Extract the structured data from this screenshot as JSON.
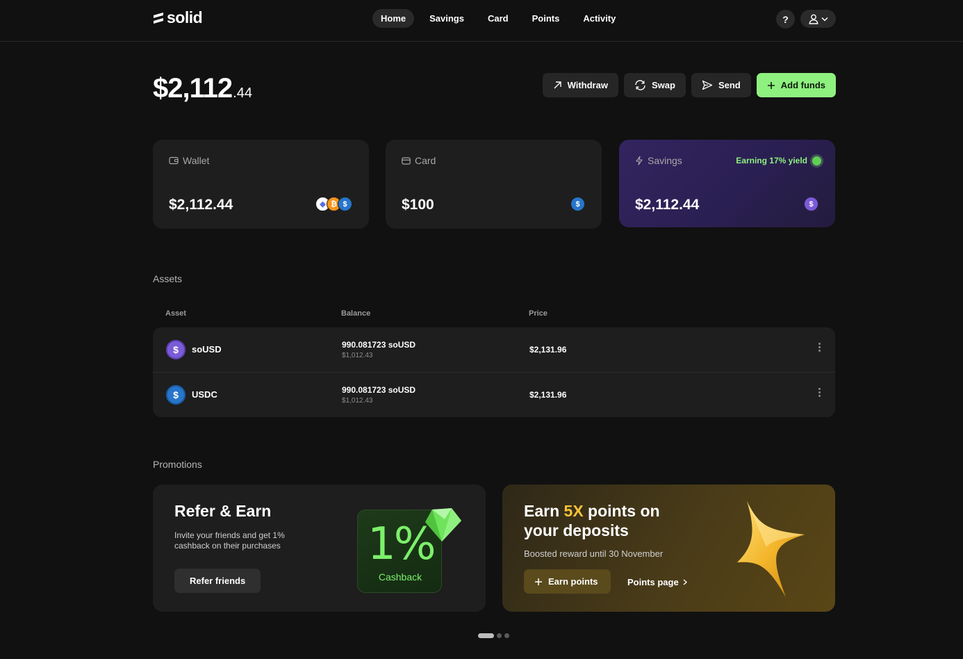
{
  "app": {
    "logo_text": "solid"
  },
  "nav": {
    "items": [
      {
        "label": "Home",
        "active": true
      },
      {
        "label": "Savings"
      },
      {
        "label": "Card"
      },
      {
        "label": "Points"
      },
      {
        "label": "Activity"
      }
    ]
  },
  "header": {
    "help_label": "?"
  },
  "balance": {
    "main": "$2,112",
    "cents": ".44"
  },
  "actions": {
    "withdraw": "Withdraw",
    "swap": "Swap",
    "send": "Send",
    "add_funds": "Add funds"
  },
  "cards": {
    "wallet": {
      "label": "Wallet",
      "amount": "$2,112.44",
      "icons": [
        "eth-icon",
        "btc-icon",
        "usdc-icon"
      ]
    },
    "card": {
      "label": "Card",
      "amount": "$100",
      "icons": [
        "usdc-icon"
      ]
    },
    "savings": {
      "label": "Savings",
      "amount": "$2,112.44",
      "yield": "Earning 17% yield",
      "icons": [
        "sousd-icon"
      ]
    }
  },
  "assets": {
    "title": "Assets",
    "columns": {
      "asset": "Asset",
      "balance": "Balance",
      "price": "Price"
    },
    "rows": [
      {
        "name": "soUSD",
        "balance": "990.081723 soUSD",
        "balance_usd": "$1,012.43",
        "price": "$2,131.96",
        "coin_color": "#7b5bd6"
      },
      {
        "name": "USDC",
        "balance": "990.081723 soUSD",
        "balance_usd": "$1,012.43",
        "price": "$2,131.96",
        "coin_color": "#2775ca"
      }
    ]
  },
  "promotions": {
    "title": "Promotions",
    "refer": {
      "title": "Refer & Earn",
      "text_line1": "Invite your friends and get 1%",
      "text_line2": "cashback on their purchases",
      "button": "Refer friends",
      "badge_value": "1%",
      "badge_label": "Cashback"
    },
    "earn": {
      "title_pre": "Earn ",
      "title_accent": "5X",
      "title_post": " points on",
      "title_line2": "your deposits",
      "text": "Boosted reward until 30 November",
      "button": "Earn points",
      "link": "Points page"
    },
    "carousel": {
      "count": 3,
      "active": 1
    }
  },
  "colors": {
    "accent_green": "#8ef07f",
    "accent_gold": "#f5c23a",
    "savings_purple": "#33245f"
  }
}
